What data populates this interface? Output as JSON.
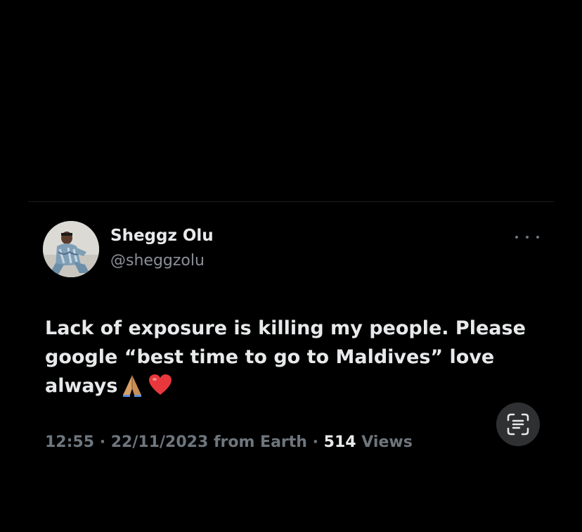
{
  "tweet": {
    "display_name": "Sheggz Olu",
    "handle": "@sheggzolu",
    "text_line1": "Lack of exposure is killing my people. Please",
    "text_line2": "google “best time to go to Maldives” love",
    "text_line3": "always",
    "emojis": [
      "pray-hands-emoji",
      "red-heart-emoji"
    ],
    "time": "12:55",
    "separator": "·",
    "date": "22/11/2023",
    "source": "from Earth",
    "views_count": "514",
    "views_label": "Views"
  },
  "icons": {
    "more": "more-horizontal-icon",
    "scan": "text-scan-icon"
  },
  "colors": {
    "background": "#000000",
    "primary_text": "#e7e9ea",
    "secondary_text": "#6e767d",
    "divider": "#1c1c1c",
    "heart": "#e8383d"
  }
}
